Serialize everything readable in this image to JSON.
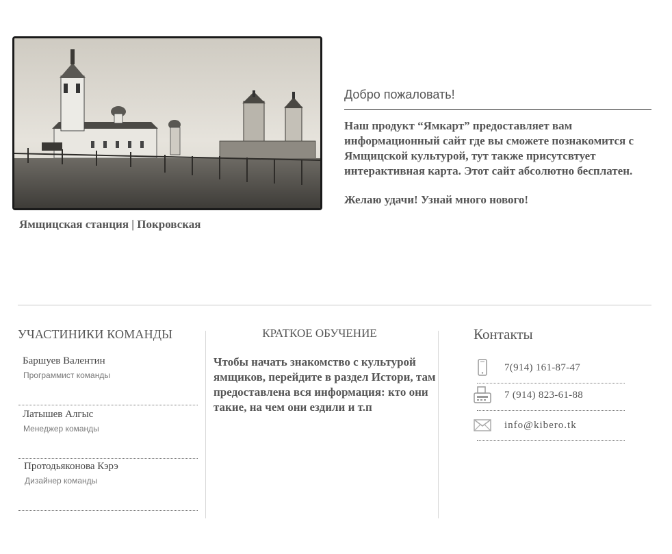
{
  "hero": {
    "caption": "Ямщицская станция | Покровская"
  },
  "welcome": {
    "title": "Добро пожаловать!",
    "body": "Наш продукт “Ямкарт” предоставляет вам информационный сайт где вы сможете познакомится с Ямщицской культурой, тут также присутсвтует интерактивная карта. Этот сайт абсолютно бесплатен.",
    "wish": "Желаю удачи! Узнай много нового!"
  },
  "team": {
    "title": "УЧАСТИНИКИ КОМАНДЫ",
    "members": [
      {
        "name": "Баршуев Валентин",
        "role": "Программист команды"
      },
      {
        "name": "Латышев Алгыс",
        "role": "Менеджер команды"
      },
      {
        "name": "Протодьяконова Кэрэ",
        "role": "Дизайнер команды"
      }
    ]
  },
  "tutorial": {
    "title": "КРАТКОЕ ОБУЧЕНИЕ",
    "body": "Чтобы начать знакомство с культурой ямщиков, перейдите  в раздел Истори, там предоставлена вся информация: кто они такие, на чем они ездили и т.п"
  },
  "contacts": {
    "title": "Контакты",
    "items": [
      {
        "icon": "phone-icon",
        "text": "7(914) 161-87-47"
      },
      {
        "icon": "fax-icon",
        "text": "7 (914) 823-61-88"
      },
      {
        "icon": "mail-icon",
        "text": "info@kibero.tk"
      }
    ]
  }
}
